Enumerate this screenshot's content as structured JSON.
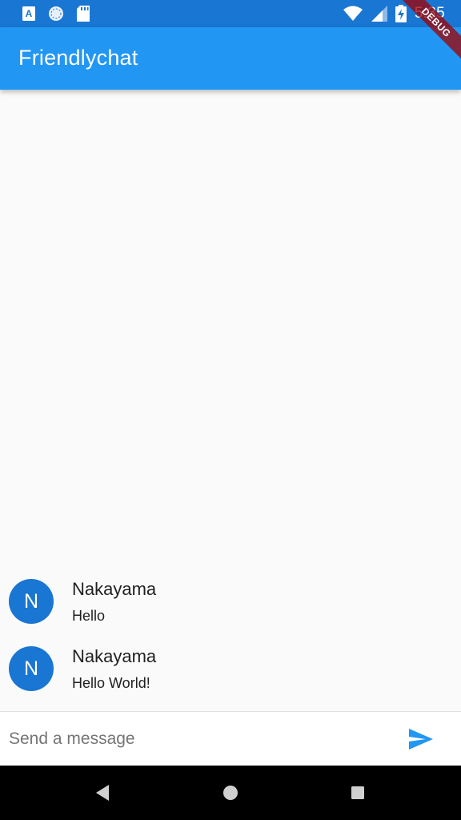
{
  "status_bar": {
    "time": "5:35",
    "background": "#1976d2",
    "left_icons": [
      "font-icon",
      "sync-icon",
      "sd-card-icon"
    ],
    "right_icons": [
      "wifi-icon",
      "signal-icon",
      "battery-charging-icon"
    ]
  },
  "debug_banner": {
    "label": "DEBUG"
  },
  "app_bar": {
    "title": "Friendlychat",
    "color": "#2196f3"
  },
  "messages": [
    {
      "avatar_initial": "N",
      "sender": "Nakayama",
      "text": "Hello"
    },
    {
      "avatar_initial": "N",
      "sender": "Nakayama",
      "text": "Hello World!"
    }
  ],
  "composer": {
    "placeholder": "Send a message",
    "value": "",
    "send_icon": "send-icon",
    "accent": "#2196f3"
  },
  "nav_bar": {
    "buttons": [
      "back-icon",
      "home-icon",
      "recents-icon"
    ]
  }
}
